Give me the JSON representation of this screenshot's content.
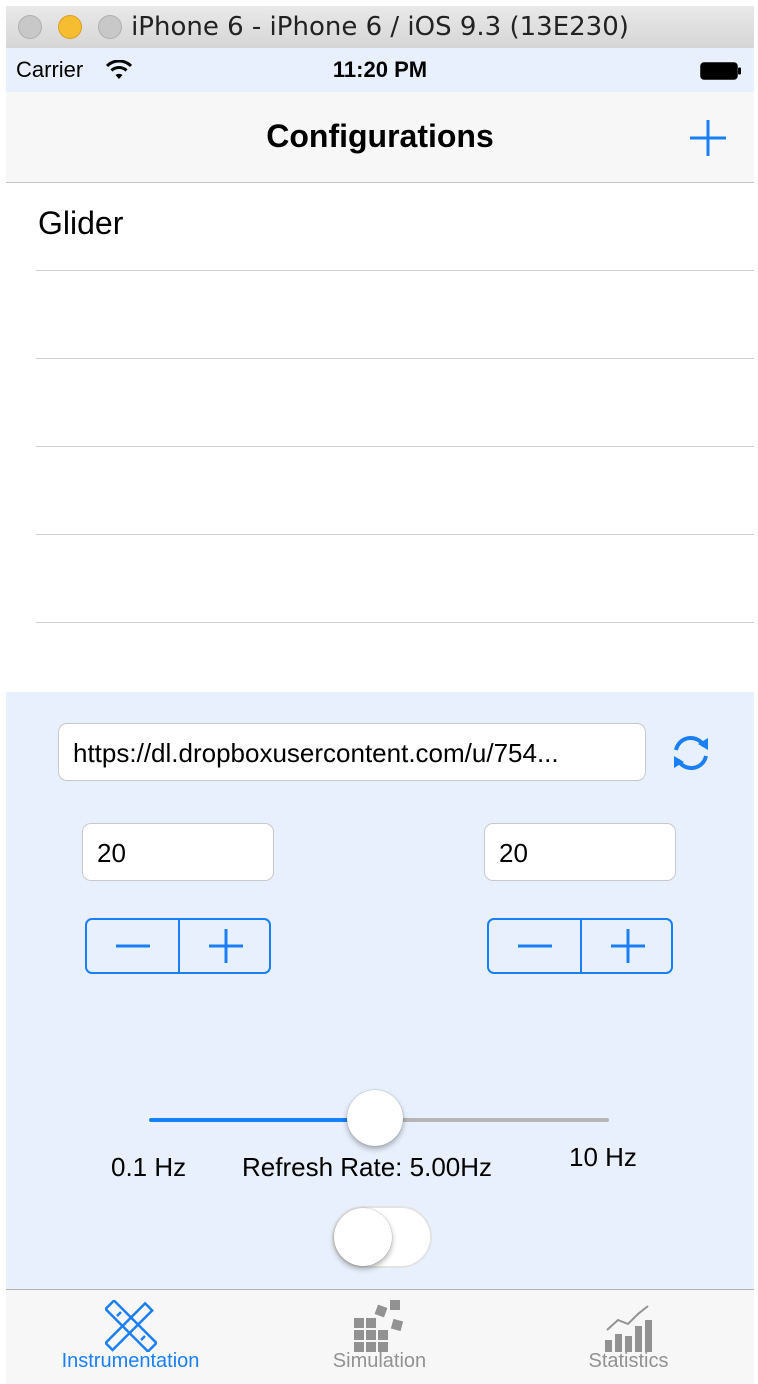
{
  "window": {
    "title": "iPhone 6 - iPhone 6 / iOS 9.3 (13E230)"
  },
  "status_bar": {
    "carrier": "Carrier",
    "time": "11:20 PM"
  },
  "nav": {
    "title": "Configurations",
    "add_icon": "plus-icon"
  },
  "list": {
    "items": [
      "Glider",
      "",
      "",
      "",
      "",
      ""
    ]
  },
  "controls": {
    "url_value": "https://dl.dropboxusercontent.com/u/754...",
    "refresh_icon": "refresh-icon",
    "left_field": "20",
    "right_field": "20",
    "slider": {
      "min_label": "0.1 Hz",
      "max_label": "10 Hz",
      "value_label": "Refresh Rate: 5.00Hz",
      "fraction": 0.49
    },
    "toggle_on": false
  },
  "tabs": [
    {
      "label": "Instrumentation",
      "icon": "ruler-pencil-icon",
      "active": true
    },
    {
      "label": "Simulation",
      "icon": "blocks-icon",
      "active": false
    },
    {
      "label": "Statistics",
      "icon": "bar-chart-icon",
      "active": false
    }
  ],
  "colors": {
    "accent": "#1a7ff5",
    "panel_bg": "#e8f0fd",
    "inactive_tab": "#929292"
  }
}
